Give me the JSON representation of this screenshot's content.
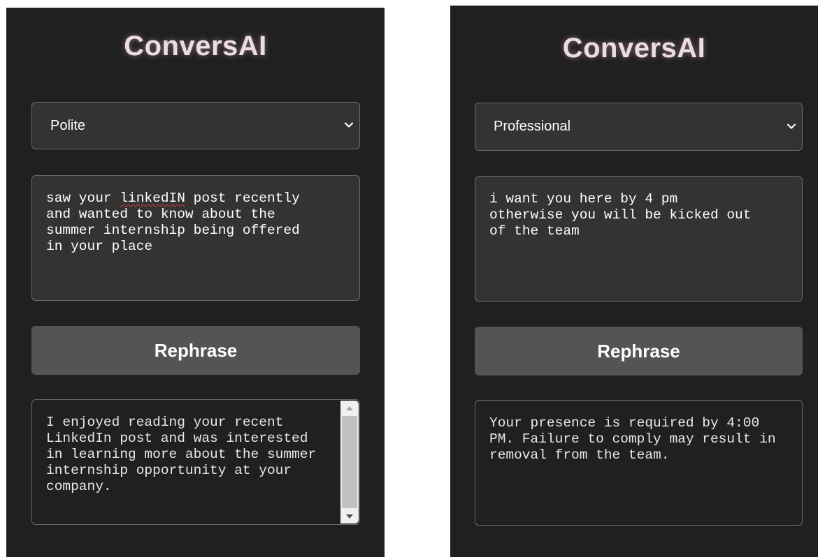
{
  "app_title": "ConversAI",
  "left": {
    "tone": "Polite",
    "input_prefix": "saw your ",
    "input_misspelled": "linkedIN",
    "input_suffix": " post recently\nand wanted to know about the\nsummer internship being offered\nin your place",
    "button_label": "Rephrase",
    "output": "I enjoyed reading your recent LinkedIn post and was interested in learning more about the summer internship opportunity at your company."
  },
  "right": {
    "tone": "Professional",
    "input": "i want you here by 4 pm\notherwise you will be kicked out\nof the team",
    "button_label": "Rephrase",
    "output": "Your presence is required by 4:00 PM. Failure to comply may result in removal from the team."
  },
  "icons": {
    "select_arrow": "chevron-down-icon",
    "scroll_up": "scroll-up-arrow-icon",
    "scroll_down": "scroll-down-arrow-icon"
  },
  "colors": {
    "panel_bg": "#202020",
    "field_bg": "#333333",
    "button_bg": "#545454",
    "title_color": "#ecdce3"
  }
}
